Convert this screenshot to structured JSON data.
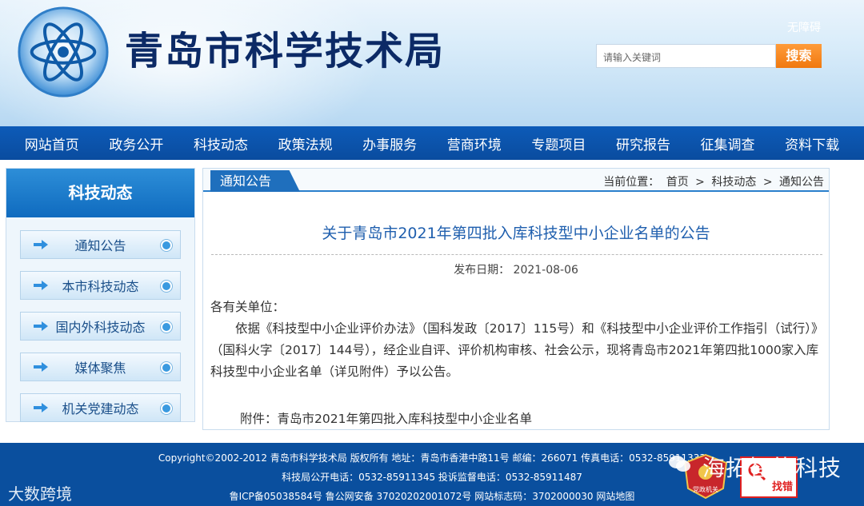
{
  "header": {
    "site_title": "青岛市科学技术局",
    "a11y_label": "无障碍",
    "search_placeholder": "请输入关键词",
    "search_button": "搜索"
  },
  "nav": {
    "items": [
      "网站首页",
      "政务公开",
      "科技动态",
      "政策法规",
      "办事服务",
      "营商环境",
      "专题项目",
      "研究报告",
      "征集调查",
      "资料下载"
    ]
  },
  "sidebar": {
    "title": "科技动态",
    "items": [
      "通知公告",
      "本市科技动态",
      "国内外科技动态",
      "媒体聚焦",
      "机关党建动态"
    ]
  },
  "panel": {
    "tab": "通知公告",
    "breadcrumb_label": "当前位置：",
    "breadcrumb": [
      "首页",
      ">",
      "科技动态",
      ">",
      "通知公告"
    ],
    "article_title": "关于青岛市2021年第四批入库科技型中小企业名单的公告",
    "pub_date": "发布日期：  2021-08-06",
    "salutation": "各有关单位：",
    "paragraph": "依据《科技型中小企业评价办法》（国科发政〔2017〕115号）和《科技型中小企业评价工作指引（试行）》（国科火字〔2017〕144号），经企业自评、评价机构审核、社会公示，现将青岛市2021年第四批1000家入库科技型中小企业名单（详见附件）予以公告。",
    "attachment": "附件：青岛市2021年第四批入库科技型中小企业名单"
  },
  "footer": {
    "line1": "Copyright©2002-2012 青岛市科学技术局 版权所有 地址：青岛市香港中路11号 邮编：266071 传真电话：0532-85911333",
    "line2": "科技局公开电话：0532-85911345 投诉监督电话：0532-85911487",
    "line3": "鲁ICP备05038584号  鲁公网安备 37020202001072号  网站标志码：3702000030  网站地图",
    "watermark": "大数跨境",
    "overlay_text": "海拓智能科技",
    "badge_text": "党政机关",
    "find_error": "找错"
  }
}
